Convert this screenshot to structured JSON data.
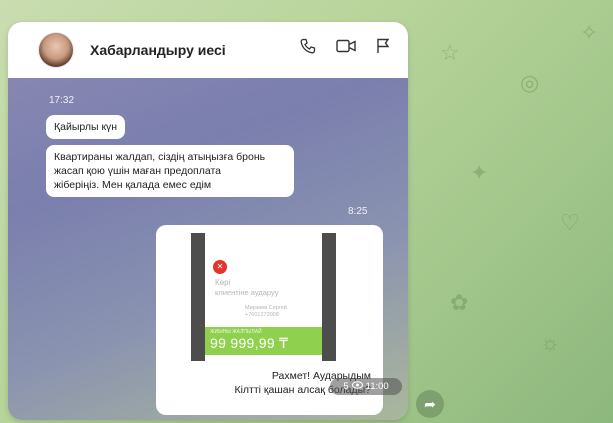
{
  "header": {
    "contact_name": "Хабарландыру иесі",
    "icons": [
      "phone-icon",
      "video-icon",
      "flag-icon"
    ]
  },
  "messages": [
    {
      "time": "17:32"
    },
    {
      "text": "Қайырлы күн"
    },
    {
      "text_lines": [
        "Квартираны жалдап, сіздің атыңызға бронь",
        "жасап қою үшін маған предоплата",
        "жіберіңіз. Мен қалада емес едім"
      ]
    },
    {
      "time": "8:25"
    }
  ],
  "receipt": {
    "title": "Көрі",
    "subtitle": "клиентіне аударуу",
    "recipient_name": "Мирзаев Сергей",
    "recipient_phone": "+7601272008",
    "small_label": "ЖИЫНЫ ЖАЛПЫЛАЙ",
    "amount": "99 999,99 ₸"
  },
  "caption_lines": [
    "Рахмет! Аударыдым",
    "Кілтті қашан алсақ болады?"
  ],
  "meta": {
    "views": "5",
    "time": "11:00"
  },
  "colors": {
    "accent_green": "#8fd14f",
    "logo_red": "#e3352d"
  }
}
